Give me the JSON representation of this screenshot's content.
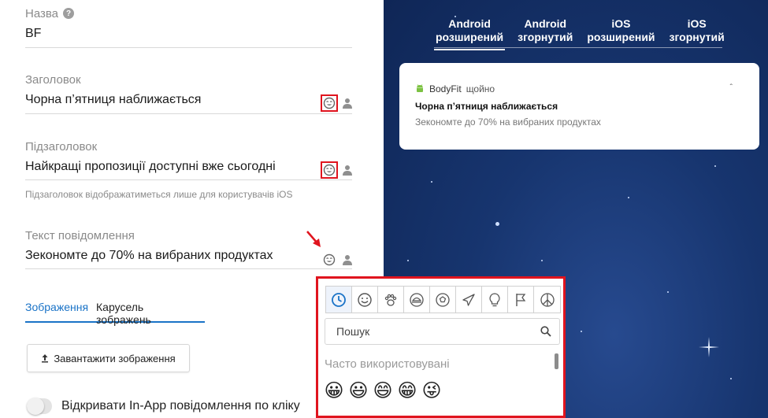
{
  "form": {
    "name": {
      "label": "Назва",
      "value": "BF"
    },
    "title": {
      "label": "Заголовок",
      "value": "Чорна п’ятниця наближається"
    },
    "subtitle": {
      "label": "Підзаголовок",
      "value": "Найкращі пропозиції доступні вже сьогодні",
      "hint": "Підзаголовок відображатиметься лише для користувачів iOS"
    },
    "message": {
      "label": "Текст повідомлення",
      "value": "Зекономте до 70% на вибраних продуктах"
    },
    "image_tabs": [
      {
        "label": "Зображення"
      },
      {
        "label": "Карусель зображень"
      }
    ],
    "upload_label": "Завантажити зображення",
    "toggle_label": "Відкривати In-App повідомлення по кліку"
  },
  "preview": {
    "tabs": [
      {
        "line1": "Android",
        "line2": "розширений"
      },
      {
        "line1": "Android",
        "line2": "згорнутий"
      },
      {
        "line1": "iOS",
        "line2": "розширений"
      },
      {
        "line1": "iOS",
        "line2": "згорнутий"
      }
    ],
    "notification": {
      "app": "BodyFit",
      "time": "щойно",
      "title": "Чорна п’ятниця наближається",
      "body": "Зекономте до 70% на вибраних продуктах"
    }
  },
  "emoji_picker": {
    "categories": [
      "clock-icon",
      "smiley-icon",
      "paw-icon",
      "food-icon",
      "ball-icon",
      "plane-icon",
      "bulb-icon",
      "flag-icon",
      "peace-icon"
    ],
    "search_placeholder": "Пошук",
    "section_title": "Часто використовувані",
    "emojis": [
      "😀",
      "😃",
      "😄",
      "😁",
      "😜"
    ]
  },
  "colors": {
    "accent": "#1a73c7",
    "highlight": "#e0141e",
    "preview_bg": "#17356f"
  }
}
